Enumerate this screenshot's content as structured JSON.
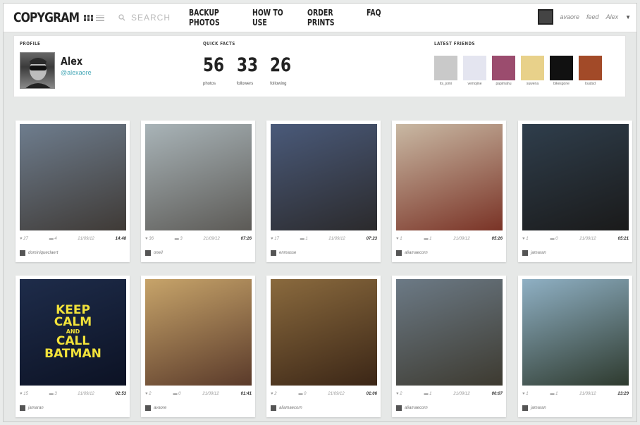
{
  "app": {
    "logo": "COPYGRAM"
  },
  "search": {
    "placeholder": "SEARCH"
  },
  "nav": [
    "BACKUP PHOTOS",
    "HOW TO USE",
    "ORDER PRINTS",
    "FAQ"
  ],
  "user_menu": {
    "username": "avaore",
    "feed": "feed",
    "menu": "Alex",
    "icon": "user-avatar-icon"
  },
  "profile": {
    "section_label": "PROFILE",
    "name": "Alex",
    "handle": "@alexaore"
  },
  "quick_facts": {
    "section_label": "QUICK FACTS",
    "items": [
      {
        "value": "56",
        "label": "photos"
      },
      {
        "value": "33",
        "label": "followers"
      },
      {
        "value": "26",
        "label": "following"
      }
    ]
  },
  "latest_friends": {
    "section_label": "LATEST FRIENDS",
    "items": [
      {
        "name": "its_jomi",
        "color": "#c9c9c9"
      },
      {
        "name": "vemojine",
        "color": "#e4e5f0"
      },
      {
        "name": "papimahu",
        "color": "#9b4c6e"
      },
      {
        "name": "suwena",
        "color": "#e8d18a"
      },
      {
        "name": "bikesgone",
        "color": "#111111"
      },
      {
        "name": "loudsd",
        "color": "#a24a28"
      }
    ]
  },
  "photos": [
    {
      "likes": "27",
      "comments": "4",
      "date": "21/09/12",
      "time": "14:48",
      "owner": "dominiqueclaert",
      "colors": [
        "#6e7d8e",
        "#3f3a36"
      ]
    },
    {
      "likes": "36",
      "comments": "3",
      "date": "21/09/12",
      "time": "07:26",
      "owner": "oneil",
      "colors": [
        "#a9b4b8",
        "#5c5a56"
      ]
    },
    {
      "likes": "17",
      "comments": "1",
      "date": "21/09/12",
      "time": "07:23",
      "owner": "enmasse",
      "colors": [
        "#4a5a7a",
        "#2b2a2c"
      ]
    },
    {
      "likes": "1",
      "comments": "1",
      "date": "21/09/12",
      "time": "05:26",
      "owner": "aliamaecorn",
      "colors": [
        "#c9b9a4",
        "#7a3326"
      ]
    },
    {
      "likes": "1",
      "comments": "0",
      "date": "21/09/12",
      "time": "05:21",
      "owner": "jamaran",
      "colors": [
        "#2f3e4c",
        "#1a1a1a"
      ]
    },
    {
      "likes": "15",
      "comments": "3",
      "date": "21/09/12",
      "time": "02:53",
      "owner": "jamaran",
      "colors": [
        "#1e2c4a",
        "#0c1224"
      ],
      "poster": {
        "lines": [
          "KEEP",
          "CALM",
          "AND",
          "CALL",
          "BATMAN"
        ]
      }
    },
    {
      "likes": "2",
      "comments": "0",
      "date": "21/09/12",
      "time": "01:41",
      "owner": "avaore",
      "colors": [
        "#c7a46a",
        "#5a3a2a"
      ]
    },
    {
      "likes": "2",
      "comments": "0",
      "date": "21/09/12",
      "time": "01:06",
      "owner": "aliamaecorn",
      "colors": [
        "#8a6a3e",
        "#3b2616"
      ]
    },
    {
      "likes": "2",
      "comments": "1",
      "date": "21/09/12",
      "time": "00:07",
      "owner": "aliamaecorn",
      "colors": [
        "#6c7a86",
        "#3d3a30"
      ]
    },
    {
      "likes": "1",
      "comments": "1",
      "date": "21/09/12",
      "time": "23:29",
      "owner": "jamaran",
      "colors": [
        "#8fb0c4",
        "#2e3a2e"
      ]
    }
  ]
}
